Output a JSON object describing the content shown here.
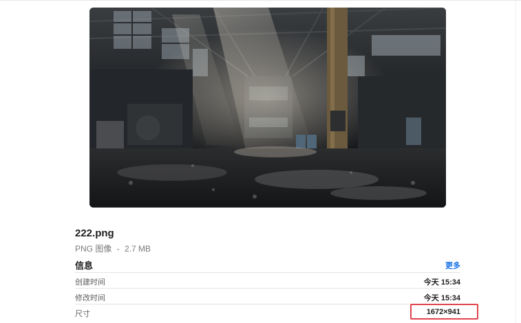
{
  "preview": {
    "icon": "factory-photo"
  },
  "file": {
    "name": "222.png",
    "type": "PNG 图像",
    "separator": "-",
    "size": "2.7 MB"
  },
  "info": {
    "title": "信息",
    "more_label": "更多",
    "rows": [
      {
        "label": "创建时间",
        "value": "今天 15:34"
      },
      {
        "label": "修改时间",
        "value": "今天 15:34"
      },
      {
        "label": "尺寸",
        "value": "1672×941"
      }
    ]
  },
  "colors": {
    "link": "#1a73e8",
    "highlight": "#e0444c"
  }
}
